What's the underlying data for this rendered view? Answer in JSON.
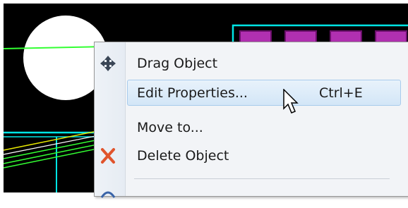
{
  "context_menu": {
    "items": [
      {
        "label": "Drag Object",
        "shortcut": "",
        "icon": "move-arrows-icon"
      },
      {
        "label": "Edit Properties...",
        "shortcut": "Ctrl+E",
        "icon": ""
      },
      {
        "label": "Move to...",
        "shortcut": "",
        "icon": ""
      },
      {
        "label": "Delete Object",
        "shortcut": "",
        "icon": "delete-x-icon"
      }
    ],
    "highlighted_index": 1
  },
  "colors": {
    "canvas_background": "#000000",
    "trace_cyan": "#00e5e5",
    "trace_yellow": "#e8e800",
    "trace_green": "#33ff33",
    "pad_magenta": "#b030b0",
    "delete_red": "#e0542c"
  }
}
